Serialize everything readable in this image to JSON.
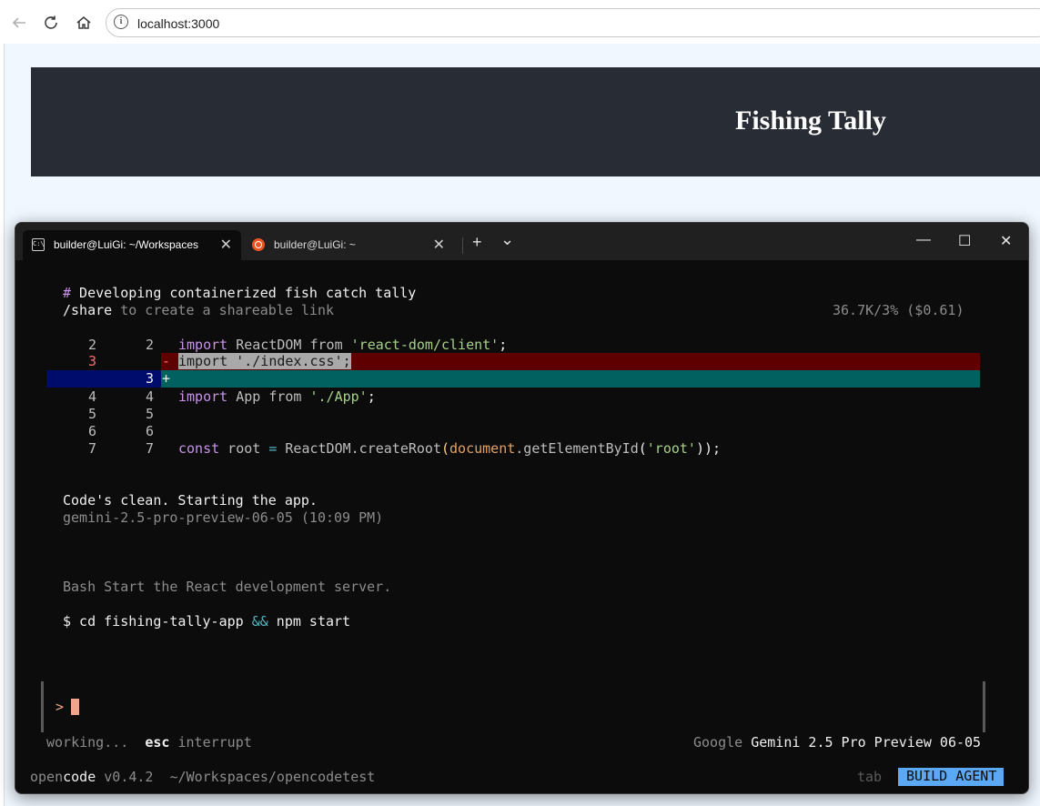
{
  "browser": {
    "url": "localhost:3000",
    "back_icon": "arrow-left-icon",
    "reload_icon": "reload-icon",
    "home_icon": "home-icon",
    "info_icon": "info-icon"
  },
  "page": {
    "title": "Fishing Tally"
  },
  "terminal": {
    "tabs": [
      {
        "label": "builder@LuiGi: ~/Workspaces",
        "close": "✕"
      },
      {
        "label": "builder@LuiGi: ~",
        "close": "✕"
      }
    ],
    "new_tab": "+",
    "dropdown": "⌄",
    "window_controls": {
      "minimize": "—",
      "maximize": "☐",
      "close": "✕"
    },
    "session": {
      "hash": "#",
      "title": " Developing containerized fish catch tally",
      "share_cmd": "/share",
      "share_text": " to create a shareable link",
      "usage": "36.7K/3% ($0.61)"
    },
    "diff": {
      "line2": {
        "old": "2",
        "new": "2",
        "kw": "import",
        "name": " ReactDOM ",
        "from": "from",
        "str": " 'react-dom/client'",
        "end": ";"
      },
      "del": {
        "old": "3",
        "sign": "-",
        "code": "import './index.css';"
      },
      "add": {
        "new": "3",
        "sign": "+"
      },
      "line4": {
        "old": "4",
        "new": "4",
        "kw": "import",
        "name": " App ",
        "from": "from",
        "str": " './App'",
        "end": ";"
      },
      "line5": {
        "old": "5",
        "new": "5"
      },
      "line6": {
        "old": "6",
        "new": "6"
      },
      "line7": {
        "old": "7",
        "new": "7",
        "kw": "const",
        "var": " root ",
        "op": "=",
        "obj": " ReactDOM",
        "method": ".createRoot",
        "p1": "(",
        "doc": "document",
        "get": ".getElementById",
        "p2": "(",
        "str": "'root'",
        "p3": "));"
      }
    },
    "message": {
      "text": "Code's clean. Starting the app.",
      "meta": "gemini-2.5-pro-preview-06-05 (10:09 PM)"
    },
    "bash": {
      "label": "Bash Start the React development server.",
      "prompt": "$",
      "cmd1": " cd fishing-tally-app ",
      "and": "&&",
      "cmd2": " npm start"
    },
    "input": {
      "prompt": ">"
    },
    "status": {
      "working": "working...",
      "esc": "esc",
      "interrupt": " interrupt",
      "provider": "Google ",
      "model": "Gemini 2.5 Pro Preview 06-05"
    },
    "footer": {
      "open": "open",
      "code": "code",
      "version": " v0.4.2",
      "path": "  ~/Workspaces/opencodetest",
      "tab": "tab",
      "agent": " BUILD AGENT"
    }
  },
  "colors": {
    "header_bg": "#282c34",
    "page_bg": "#f0f7ff",
    "diff_del": "#5e0000",
    "diff_add": "#006260",
    "agent_badge": "#5ba8f5"
  }
}
